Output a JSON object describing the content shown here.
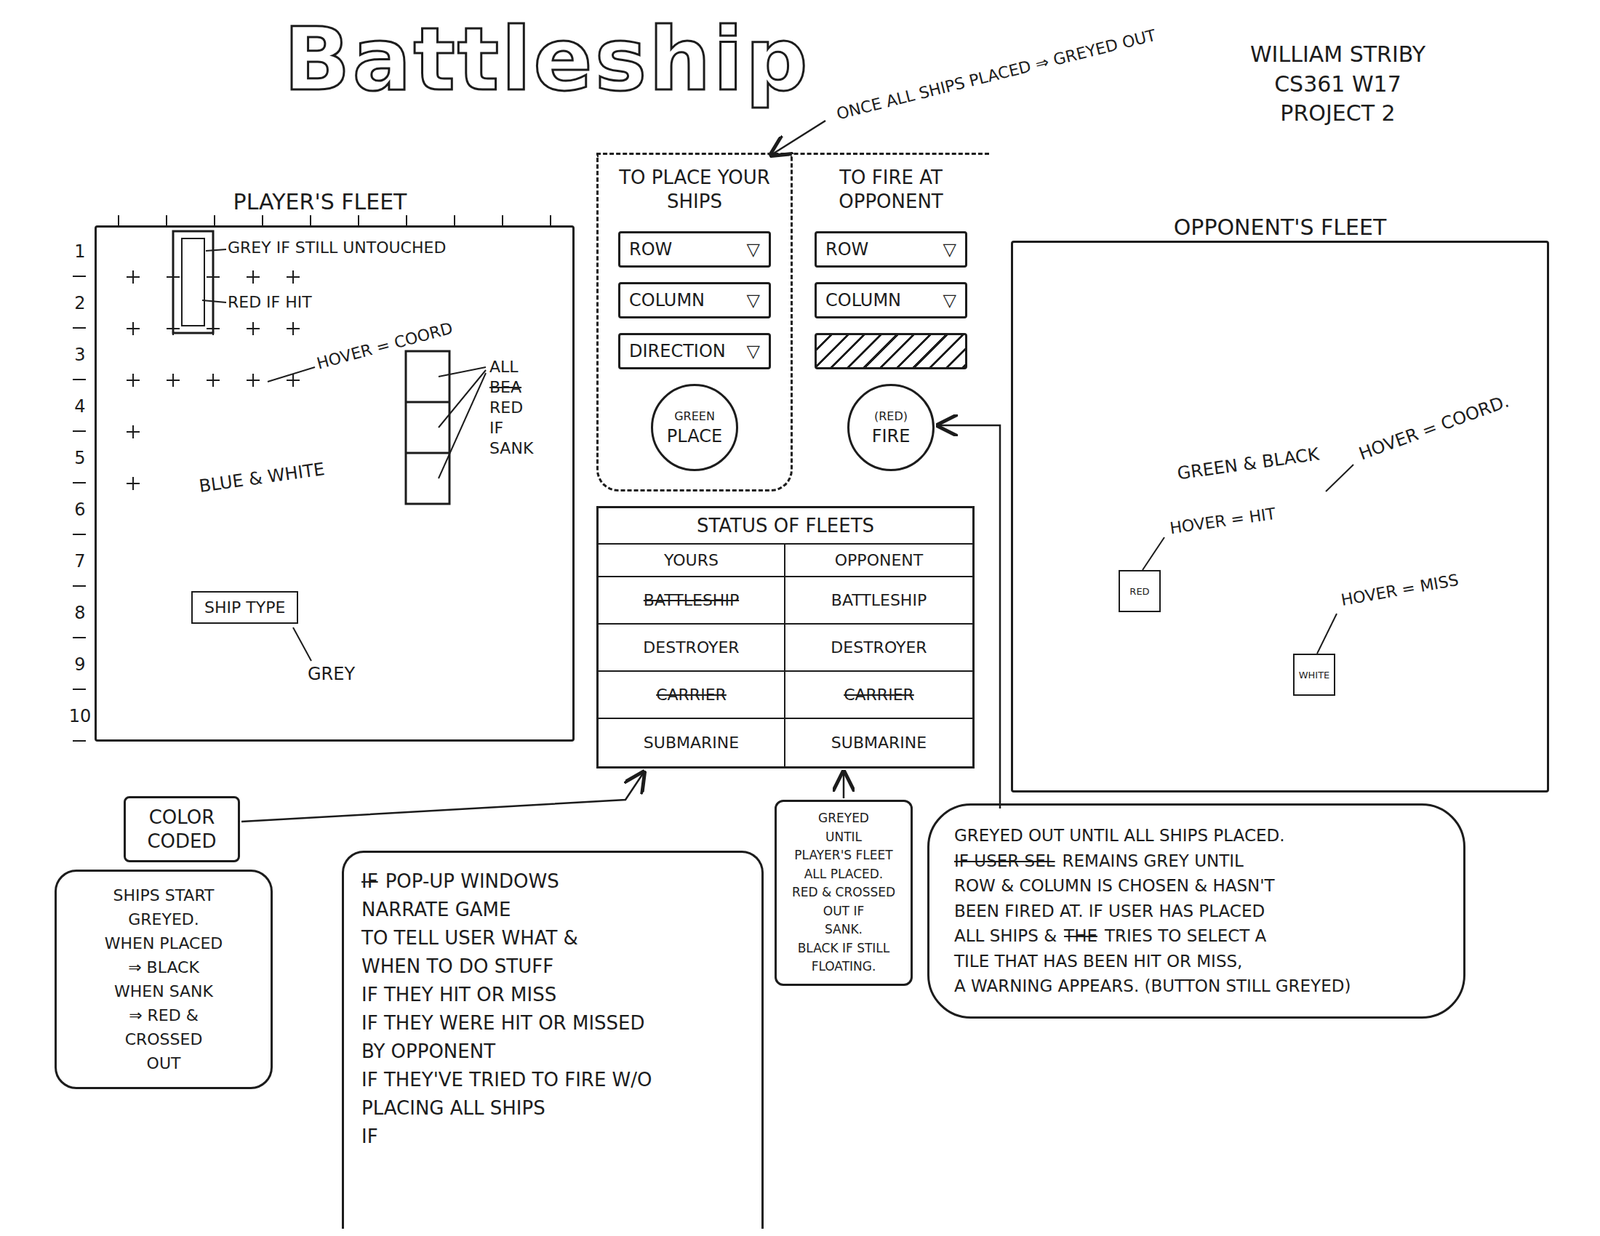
{
  "title": "Battleship",
  "header_note": "ONCE ALL SHIPS PLACED ⇒ GREYED OUT",
  "author": [
    "WILLIAM STRIBY",
    "CS361 W17",
    "PROJECT 2"
  ],
  "player_fleet": {
    "title": "PLAYER'S FLEET",
    "rows": [
      "1",
      "2",
      "3",
      "4",
      "5",
      "6",
      "7",
      "8",
      "9",
      "10"
    ],
    "marks_per_row": [
      5,
      5,
      5,
      1,
      1
    ],
    "untouched": "GREY IF STILL UNTOUCHED",
    "hit": "RED IF HIT",
    "hover": "HOVER = COORD",
    "colors": "BLUE & WHITE",
    "sank": [
      {
        "text": "ALL",
        "struck": false
      },
      {
        "text": "BEA",
        "struck": true
      },
      {
        "text": "RED",
        "struck": false
      },
      {
        "text": "IF",
        "struck": false
      },
      {
        "text": "SANK",
        "struck": false
      }
    ],
    "ship_type": "SHIP TYPE",
    "ship_type_color": "GREY"
  },
  "place": {
    "title": "TO PLACE YOUR SHIPS",
    "dropdowns": [
      {
        "kind": "select",
        "label": "ROW",
        "caret": "▽"
      },
      {
        "kind": "select",
        "label": "COLUMN",
        "caret": "▽"
      },
      {
        "kind": "select",
        "label": "DIRECTION",
        "caret": "▽"
      }
    ],
    "button": {
      "color_label": "GREEN",
      "label": "PLACE"
    }
  },
  "fire": {
    "title": "TO FIRE AT OPPONENT",
    "dropdowns": [
      {
        "kind": "select",
        "label": "ROW",
        "caret": "▽"
      },
      {
        "kind": "select",
        "label": "COLUMN",
        "caret": "▽"
      },
      {
        "kind": "hatched"
      }
    ],
    "button": {
      "color_label": "(RED)",
      "label": "FIRE"
    }
  },
  "status": {
    "title": "STATUS OF FLEETS",
    "columns": [
      "YOURS",
      "OPPONENT"
    ],
    "rows": [
      {
        "yours": {
          "text": "BATTLESHIP",
          "sunk": true
        },
        "opponent": {
          "text": "BATTLESHIP",
          "sunk": false
        }
      },
      {
        "yours": {
          "text": "DESTROYER",
          "sunk": false
        },
        "opponent": {
          "text": "DESTROYER",
          "sunk": false
        }
      },
      {
        "yours": {
          "text": "CARRIER",
          "sunk": true
        },
        "opponent": {
          "text": "CARRIER",
          "sunk": true
        }
      },
      {
        "yours": {
          "text": "SUBMARINE",
          "sunk": false
        },
        "opponent": {
          "text": "SUBMARINE",
          "sunk": false
        }
      }
    ]
  },
  "opponent_fleet": {
    "title": "OPPONENT'S FLEET",
    "colors": "GREEN & BLACK",
    "hover": "HOVER = COORD.",
    "hit": {
      "label": "HOVER = HIT",
      "cell": "RED"
    },
    "miss": {
      "label": "HOVER = MISS",
      "cell": "WHITE"
    }
  },
  "color_coded": {
    "label": "COLOR CODED",
    "lines": [
      "SHIPS START",
      "GREYED.",
      "WHEN PLACED",
      "⇒ BLACK",
      "WHEN SANK",
      "⇒ RED &",
      "CROSSED",
      "OUT"
    ]
  },
  "popup_note": {
    "lines": [
      [
        {
          "text": "IF",
          "struck": true
        },
        {
          "text": "POP-UP WINDOWS",
          "struck": false
        }
      ],
      [
        {
          "text": "NARRATE GAME",
          "struck": false
        }
      ],
      [
        {
          "text": "TO TELL USER WHAT &",
          "struck": false
        }
      ],
      [
        {
          "text": "WHEN TO DO STUFF",
          "struck": false
        }
      ],
      [
        {
          "text": "IF THEY HIT OR MISS",
          "struck": false
        }
      ],
      [
        {
          "text": "IF THEY WERE HIT OR MISSED",
          "struck": false
        }
      ],
      [
        {
          "text": "BY OPPONENT",
          "struck": false
        }
      ],
      [
        {
          "text": "IF THEY'VE TRIED TO FIRE W/O",
          "struck": false
        }
      ],
      [
        {
          "text": "PLACING ALL SHIPS",
          "struck": false
        }
      ],
      [
        {
          "text": "IF",
          "struck": false
        }
      ]
    ]
  },
  "status_note": {
    "lines": [
      "GREYED",
      "UNTIL",
      "PLAYER'S FLEET",
      "ALL PLACED.",
      "RED & CROSSED",
      "OUT IF",
      "SANK.",
      "BLACK IF STILL",
      "FLOATING."
    ]
  },
  "fire_note": {
    "lines": [
      [
        {
          "text": "GREYED OUT UNTIL ALL SHIPS PLACED.",
          "struck": false
        }
      ],
      [
        {
          "text": "IF USER SEL",
          "struck": true
        },
        {
          "text": "REMAINS GREY UNTIL",
          "struck": false
        }
      ],
      [
        {
          "text": "ROW & COLUMN IS CHOSEN & HASN'T",
          "struck": false
        }
      ],
      [
        {
          "text": "BEEN FIRED AT. IF USER HAS PLACED",
          "struck": false
        }
      ],
      [
        {
          "text": "ALL SHIPS &",
          "struck": false
        },
        {
          "text": "THE",
          "struck": true
        },
        {
          "text": "TRIES TO SELECT A",
          "struck": false
        }
      ],
      [
        {
          "text": "TILE THAT HAS BEEN HIT OR MISS,",
          "struck": false
        }
      ],
      [
        {
          "text": "A WARNING APPEARS. (BUTTON STILL GREYED)",
          "struck": false
        }
      ]
    ]
  }
}
